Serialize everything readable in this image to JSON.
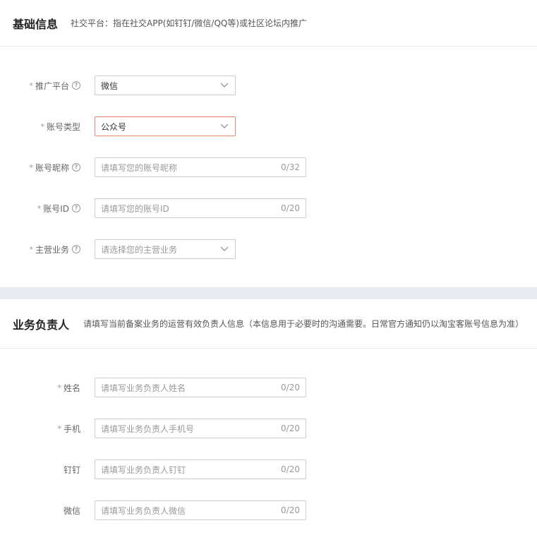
{
  "basic": {
    "title": "基础信息",
    "desc": "社交平台：指在社交APP(如钉钉/微信/QQ等)或社区论坛内推广",
    "fields": [
      {
        "label": "推广平台",
        "required": true,
        "value": "微信"
      },
      {
        "label": "账号类型",
        "required": true,
        "value": "公众号"
      },
      {
        "label": "账号昵称",
        "required": true,
        "placeholder": "请填写您的账号昵称",
        "counter": "0/32"
      },
      {
        "label": "账号ID",
        "required": true,
        "placeholder": "请填写您的账号ID",
        "counter": "0/20"
      },
      {
        "label": "主营业务",
        "required": true,
        "placeholder": "请选择您的主营业务"
      }
    ]
  },
  "owner": {
    "title": "业务负责人",
    "desc": "请填写当前备案业务的运营有效负责人信息（本信息用于必要时的沟通需要。日常官方通知仍以淘宝客账号信息为准）",
    "fields": [
      {
        "label": "姓名",
        "required": true,
        "placeholder": "请填写业务负责人姓名",
        "counter": "0/20"
      },
      {
        "label": "手机",
        "required": true,
        "placeholder": "请填写业务负责人手机号",
        "counter": "0/20"
      },
      {
        "label": "钉钉",
        "required": false,
        "placeholder": "请填写业务负责人钉钉",
        "counter": "0/20"
      },
      {
        "label": "微信",
        "required": false,
        "placeholder": "请填写业务负责人微信",
        "counter": "0/20"
      }
    ]
  },
  "ui": {
    "required_mark": "*",
    "help_glyph": "?",
    "border_focus_color": "#e9886f",
    "separator_color": "#e7eaf1"
  }
}
